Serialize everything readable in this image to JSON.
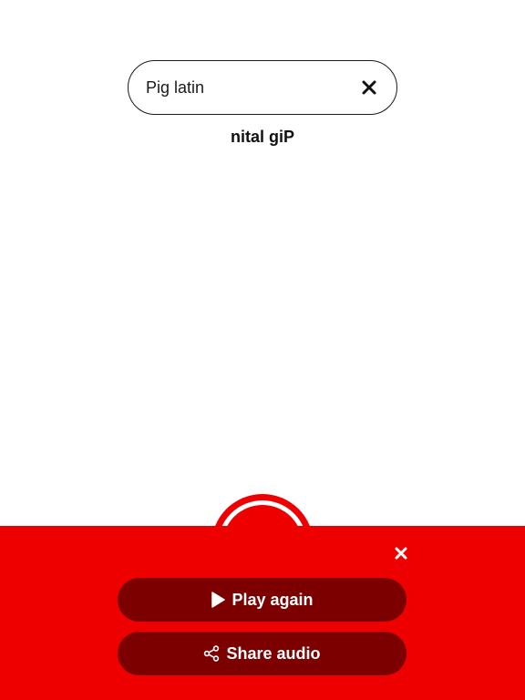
{
  "search": {
    "value": "Pig latin",
    "clear_icon": "close-icon"
  },
  "result": {
    "text": "nital giP"
  },
  "record": {
    "icon": "record-ring-icon"
  },
  "panel": {
    "close_icon": "close-icon",
    "play_label": "Play again",
    "play_icon": "play-icon",
    "share_label": "Share audio",
    "share_icon": "share-icon"
  },
  "colors": {
    "panel_bg": "#ee0000",
    "button_bg": "#7d0000",
    "text_primary": "#111111",
    "on_accent": "#ffffff"
  }
}
